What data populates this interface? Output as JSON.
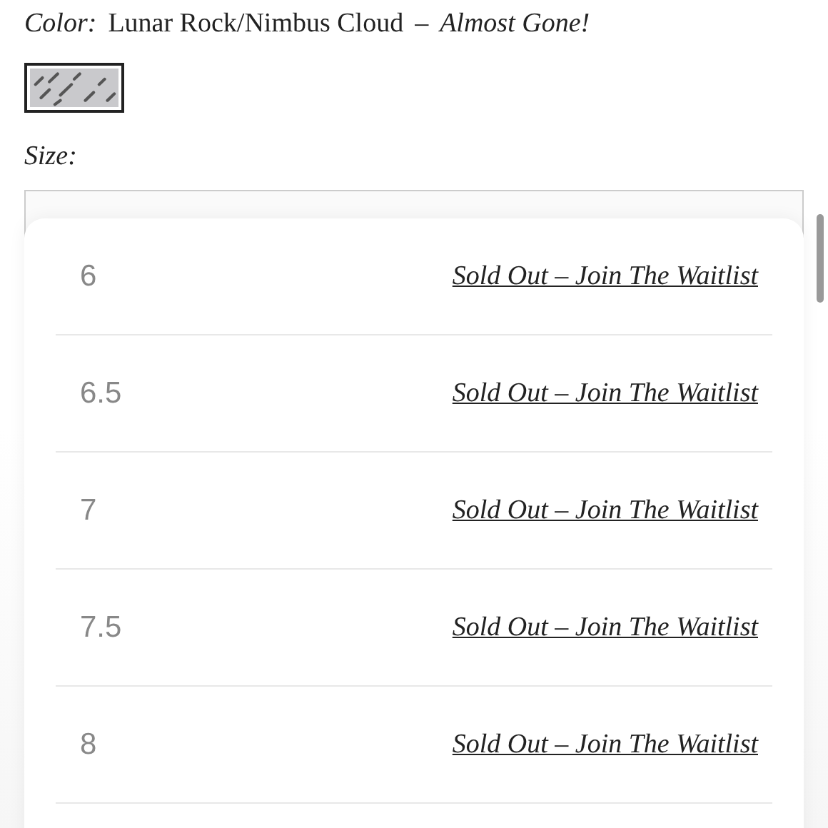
{
  "color": {
    "label": "Color:",
    "value": "Lunar Rock/Nimbus Cloud",
    "separator": "–",
    "note": "Almost Gone!"
  },
  "swatches": [
    {
      "selected": true
    }
  ],
  "size": {
    "label": "Size:"
  },
  "size_options": [
    {
      "size": "6",
      "status": "Sold Out – Join The Waitlist"
    },
    {
      "size": "6.5",
      "status": "Sold Out – Join The Waitlist"
    },
    {
      "size": "7",
      "status": "Sold Out – Join The Waitlist"
    },
    {
      "size": "7.5",
      "status": "Sold Out – Join The Waitlist"
    },
    {
      "size": "8",
      "status": "Sold Out – Join The Waitlist"
    }
  ]
}
